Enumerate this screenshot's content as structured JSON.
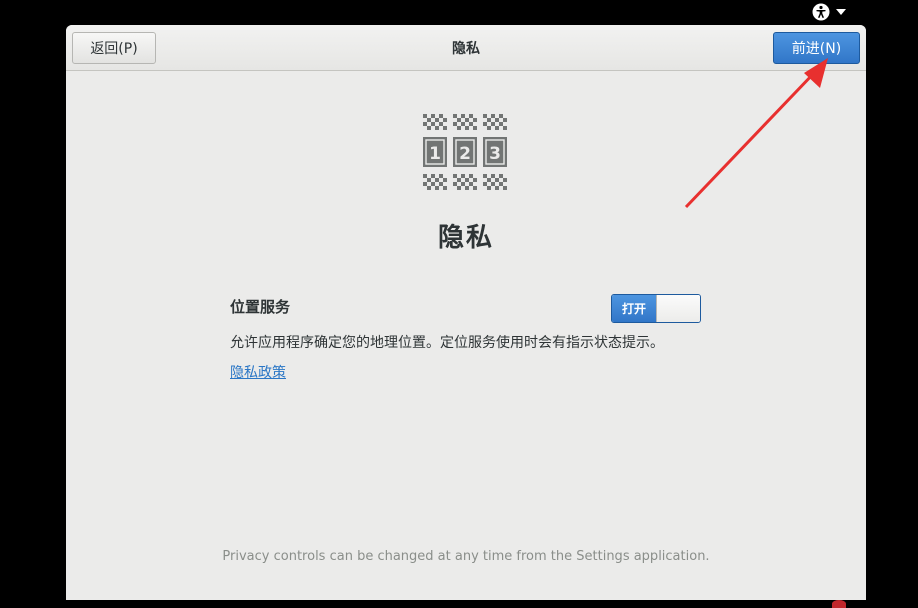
{
  "system": {
    "accessibility_icon": "accessibility-icon",
    "menu_icon": "chevron-down-icon"
  },
  "header": {
    "back_label": "返回(P)",
    "title": "隐私",
    "next_label": "前进(N)"
  },
  "page": {
    "logo_icon": "privacy-123-icon",
    "logo_digits": [
      "1",
      "2",
      "3"
    ],
    "title": "隐私",
    "location": {
      "label": "位置服务",
      "toggle_label": "打开",
      "enabled": true,
      "description": "允许应用程序确定您的地理位置。定位服务使用时会有指示状态提示。"
    },
    "policy_link": "隐私政策",
    "footer": "Privacy controls can be changed at any time from the Settings application."
  },
  "colors": {
    "accent": "#3d86d8",
    "window_bg": "#ebebea",
    "annotation": "#e8302f",
    "desktop_bg": "#000000"
  }
}
